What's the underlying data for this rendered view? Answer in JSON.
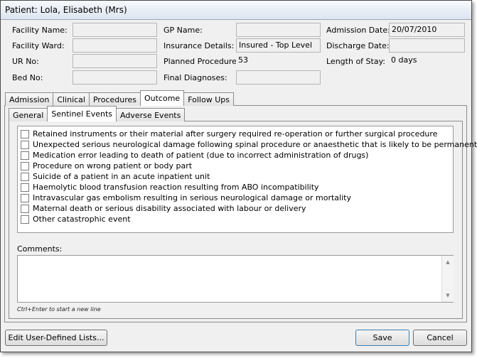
{
  "window": {
    "title": "Patient: Lola, Elisabeth (Mrs)"
  },
  "fields": {
    "facility_name": {
      "label": "Facility Name:",
      "value": ""
    },
    "facility_ward": {
      "label": "Facility Ward:",
      "value": ""
    },
    "ur_no": {
      "label": "UR No:",
      "value": ""
    },
    "bed_no": {
      "label": "Bed No:",
      "value": ""
    },
    "gp_name": {
      "label": "GP Name:",
      "value": ""
    },
    "insurance_details": {
      "label": "Insurance Details:",
      "value": "Insured - Top Level"
    },
    "planned_procedures": {
      "label": "Planned Procedures:",
      "value": "53"
    },
    "final_diagnoses": {
      "label": "Final Diagnoses:",
      "value": ""
    },
    "admission_date": {
      "label": "Admission Date:",
      "value": "20/07/2010"
    },
    "discharge_date": {
      "label": "Discharge Date:",
      "value": ""
    },
    "length_of_stay": {
      "label": "Length of Stay:",
      "value": "0 days"
    }
  },
  "main_tabs": [
    "Admission",
    "Clinical",
    "Procedures",
    "Outcome",
    "Follow Ups"
  ],
  "main_tab_active": "Outcome",
  "sub_tabs": [
    "General",
    "Sentinel Events",
    "Adverse Events"
  ],
  "sub_tab_active": "Sentinel Events",
  "sentinel_events": [
    "Retained instruments or their material after surgery required re-operation or further surgical procedure",
    "Unexpected serious neurological damage following spinal procedure or anaesthetic that is likely to be permanent",
    "Medication error leading to death of patient (due to incorrect administration of drugs)",
    "Procedure on wrong patient or body part",
    "Suicide of a patient in an acute inpatient unit",
    "Haemolytic blood transfusion reaction resulting from ABO incompatibility",
    "Intravascular gas embolism resulting in serious neurological damage or mortality",
    "Maternal death or serious disability associated with labour or delivery",
    "Other catastrophic event"
  ],
  "comments": {
    "label": "Comments:",
    "value": "",
    "hint": "Ctrl+Enter to start a new line"
  },
  "buttons": {
    "edit_lists": "Edit User-Defined Lists...",
    "save": "Save",
    "cancel": "Cancel"
  }
}
